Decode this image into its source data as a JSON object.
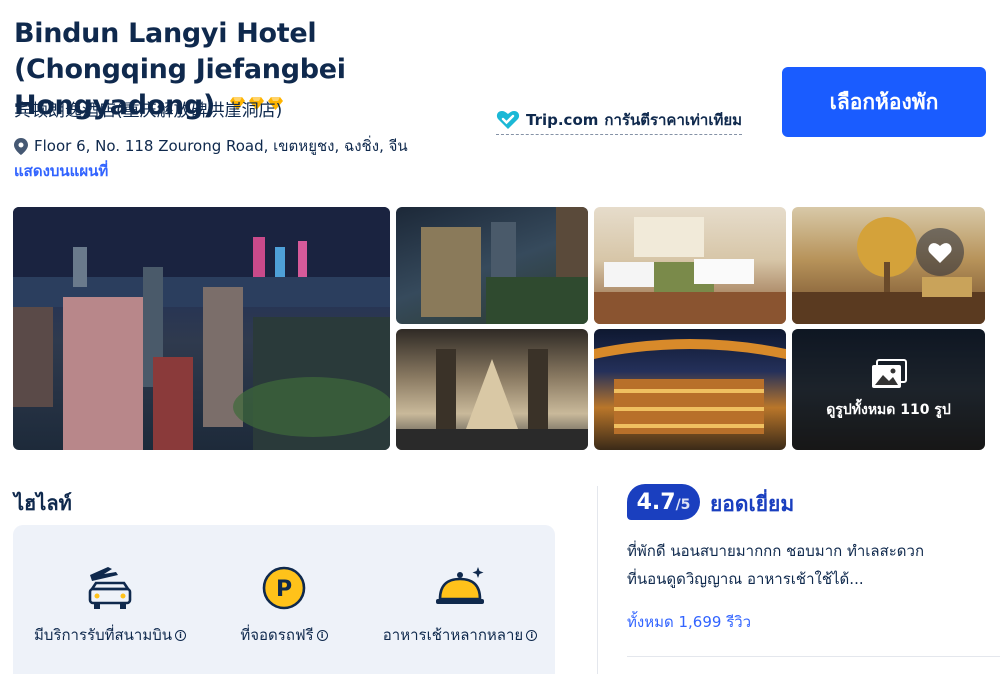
{
  "hotel": {
    "name": "Bindun Langyi Hotel (Chongqing Jiefangbei Hongyadong)",
    "name_local": "宾顿朗逸酒店(重庆解放碑洪崖洞店)",
    "star_icons": [
      "diamond-icon",
      "diamond-icon",
      "diamond-icon"
    ],
    "address": "Floor 6, No. 118 Zourong Road, เขตหยูชง, ฉงชิ่ง, จีน",
    "map_link": "แสดงบนแผนที่"
  },
  "trip_badge": {
    "brand": "Trip.com",
    "text": "การันตีราคาเท่าเทียม"
  },
  "select_room_button": "เลือกห้องพัก",
  "gallery": {
    "photos": [
      "city-night-photo",
      "hotel-exterior-photo",
      "twin-room-photo",
      "lobby-restaurant-photo",
      "lobby-hall-photo",
      "hongyadong-night-photo",
      "street-night-photo"
    ],
    "all_photos_label": "ดูรูปทั้งหมด 110 รูป"
  },
  "highlights": {
    "title": "ไฮไลท์",
    "items": [
      {
        "icon": "airport-transfer-icon",
        "label": "มีบริการรับที่สนามบิน"
      },
      {
        "icon": "parking-icon",
        "label": "ที่จอดรถฟรี"
      },
      {
        "icon": "breakfast-icon",
        "label": "อาหารเช้าหลากหลาย"
      }
    ]
  },
  "rating": {
    "score": "4.7",
    "scale": "/5",
    "word": "ยอดเยี่ยม",
    "review_snippet": "ที่พักดี นอนสบายมากกก ชอบมาก ทำเลสะดวก ที่นอนดูดวิญญาณ อาหารเช้าใช้ได้...",
    "reviews_link": "ทั้งหมด 1,699 รีวิว"
  },
  "colors": {
    "primary": "#1a5cff",
    "rating_blue": "#1a3fbf",
    "link": "#3264ff",
    "text": "#0f294d",
    "diamond": "#ffb400"
  }
}
